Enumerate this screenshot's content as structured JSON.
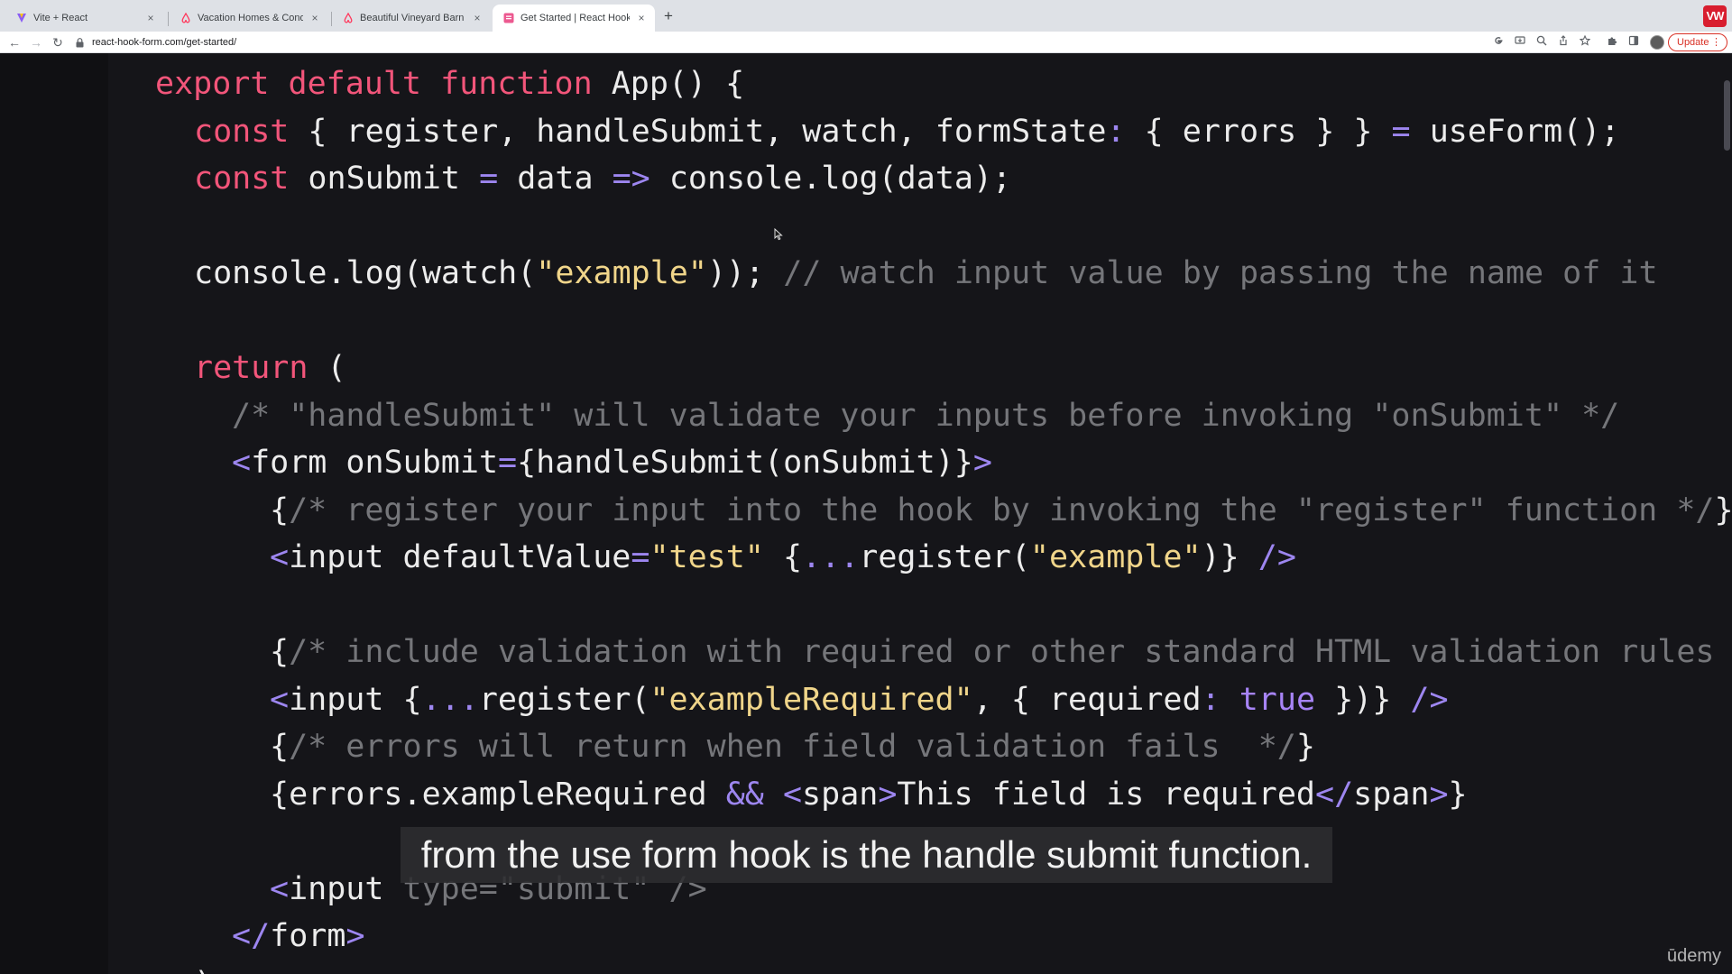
{
  "browser": {
    "tabs": [
      {
        "title": "Vite + React",
        "active": false,
        "favicon": "vite-icon"
      },
      {
        "title": "Vacation Homes & Condo Rentals - Airbnb",
        "active": false,
        "favicon": "airbnb-icon"
      },
      {
        "title": "Beautiful Vineyard Barn House",
        "active": false,
        "favicon": "airbnb-icon"
      },
      {
        "title": "Get Started | React Hook Form",
        "active": true,
        "favicon": "react-hook-form-icon"
      }
    ],
    "new_tab_label": "+",
    "close_glyph": "×",
    "profile_badge": "VW",
    "url": "react-hook-form.com/get-started/",
    "update_label": "Update",
    "menu_glyph": "⋮",
    "nav_glyphs": {
      "back": "←",
      "forward": "→",
      "reload": "↻"
    }
  },
  "code": {
    "lines": [
      {
        "indent": 0,
        "tokens": [
          [
            "kw",
            "export default function"
          ],
          [
            "tx",
            " App() {"
          ]
        ]
      },
      {
        "indent": 1,
        "tokens": [
          [
            "kw",
            "const"
          ],
          [
            "tx",
            " { register, handleSubmit, watch, formState"
          ],
          [
            "pu",
            ":"
          ],
          [
            "tx",
            " { errors } } "
          ],
          [
            "pu",
            "="
          ],
          [
            "tx",
            " useForm();"
          ]
        ]
      },
      {
        "indent": 1,
        "tokens": [
          [
            "kw",
            "const"
          ],
          [
            "tx",
            " onSubmit "
          ],
          [
            "pu",
            "="
          ],
          [
            "tx",
            " data "
          ],
          [
            "pu",
            "=>"
          ],
          [
            "tx",
            " console.log(data);"
          ]
        ]
      },
      {
        "indent": 0,
        "tokens": []
      },
      {
        "indent": 1,
        "tokens": [
          [
            "tx",
            "console.log(watch("
          ],
          [
            "str",
            "\"example\""
          ],
          [
            "tx",
            "));"
          ],
          [
            "cm",
            " // watch input value by passing the name of it"
          ]
        ]
      },
      {
        "indent": 0,
        "tokens": []
      },
      {
        "indent": 1,
        "tokens": [
          [
            "kw",
            "return"
          ],
          [
            "tx",
            " ("
          ]
        ]
      },
      {
        "indent": 2,
        "tokens": [
          [
            "cm",
            "/* \"handleSubmit\" will validate your inputs before invoking \"onSubmit\" */"
          ]
        ]
      },
      {
        "indent": 2,
        "tokens": [
          [
            "pu",
            "<"
          ],
          [
            "tx",
            "form onSubmit"
          ],
          [
            "pu",
            "="
          ],
          [
            "tx",
            "{handleSubmit(onSubmit)}"
          ],
          [
            "pu",
            ">"
          ]
        ]
      },
      {
        "indent": 3,
        "tokens": [
          [
            "tx",
            "{"
          ],
          [
            "cm",
            "/* register your input into the hook by invoking the \"register\" function */"
          ],
          [
            "tx",
            "}"
          ]
        ]
      },
      {
        "indent": 3,
        "tokens": [
          [
            "pu",
            "<"
          ],
          [
            "tx",
            "input defaultValue"
          ],
          [
            "pu",
            "="
          ],
          [
            "str",
            "\"test\""
          ],
          [
            "tx",
            " {"
          ],
          [
            "pu",
            "..."
          ],
          [
            "tx",
            "register("
          ],
          [
            "str",
            "\"example\""
          ],
          [
            "tx",
            ")} "
          ],
          [
            "pu",
            "/>"
          ]
        ]
      },
      {
        "indent": 0,
        "tokens": []
      },
      {
        "indent": 3,
        "tokens": [
          [
            "tx",
            "{"
          ],
          [
            "cm",
            "/* include validation with required or other standard HTML validation rules */"
          ],
          [
            "tx",
            "}"
          ]
        ]
      },
      {
        "indent": 3,
        "tokens": [
          [
            "pu",
            "<"
          ],
          [
            "tx",
            "input {"
          ],
          [
            "pu",
            "..."
          ],
          [
            "tx",
            "register("
          ],
          [
            "str",
            "\"exampleRequired\""
          ],
          [
            "tx",
            ", { required"
          ],
          [
            "pu",
            ":"
          ],
          [
            "bool",
            " true"
          ],
          [
            "tx",
            " })} "
          ],
          [
            "pu",
            "/>"
          ]
        ]
      },
      {
        "indent": 3,
        "tokens": [
          [
            "tx",
            "{"
          ],
          [
            "cm",
            "/* errors will return when field validation fails  */"
          ],
          [
            "tx",
            "}"
          ]
        ]
      },
      {
        "indent": 3,
        "tokens": [
          [
            "tx",
            "{errors.exampleRequired "
          ],
          [
            "pu",
            "&&"
          ],
          [
            "tx",
            " "
          ],
          [
            "pu",
            "<"
          ],
          [
            "tx",
            "span"
          ],
          [
            "pu",
            ">"
          ],
          [
            "tx",
            "This field is required"
          ],
          [
            "pu",
            "</"
          ],
          [
            "tx",
            "span"
          ],
          [
            "pu",
            ">"
          ],
          [
            "tx",
            "}"
          ]
        ]
      },
      {
        "indent": 0,
        "tokens": []
      },
      {
        "indent": 3,
        "tokens": [
          [
            "pu",
            "<"
          ],
          [
            "tx",
            "input "
          ],
          [
            "cm",
            "type=\"submit\" />"
          ]
        ]
      },
      {
        "indent": 2,
        "tokens": [
          [
            "pu",
            "</"
          ],
          [
            "tx",
            "form"
          ],
          [
            "pu",
            ">"
          ]
        ]
      },
      {
        "indent": 1,
        "tokens": [
          [
            "tx",
            ");"
          ]
        ]
      }
    ]
  },
  "caption": "from the use form hook is the handle submit function.",
  "watermark": "ūdemy"
}
